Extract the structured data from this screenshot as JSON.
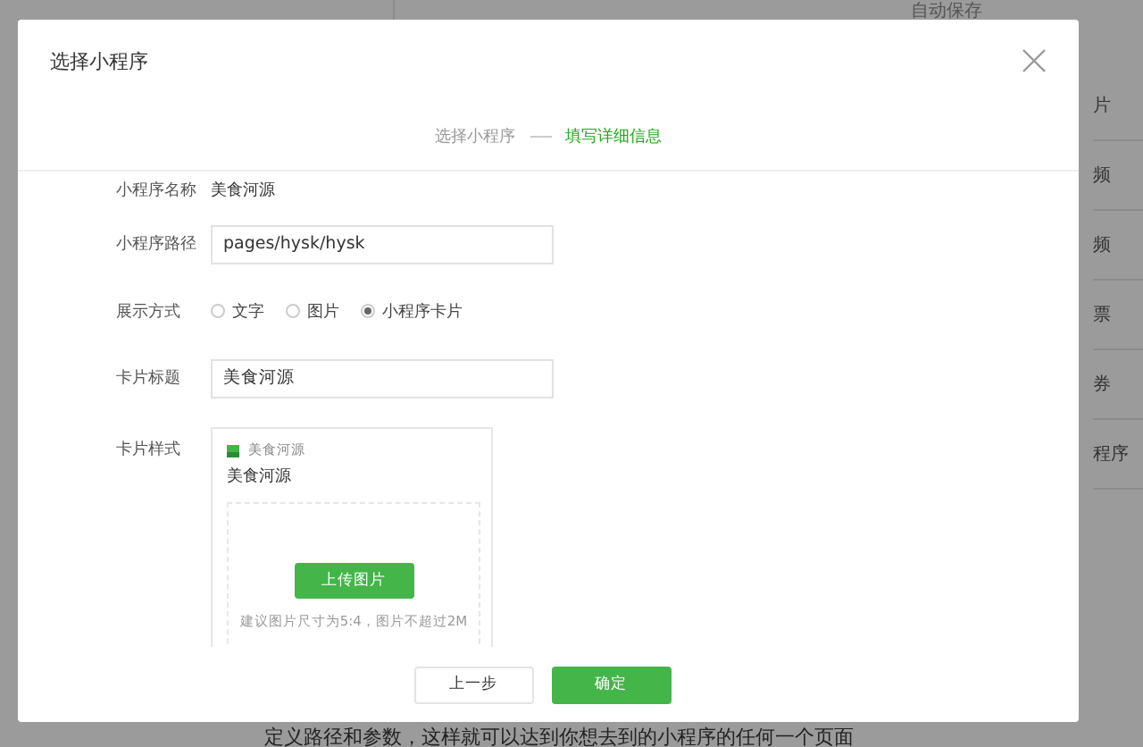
{
  "background": {
    "autosave": "自动保存",
    "side_items": [
      "片",
      "频",
      "频",
      "票",
      "券",
      "程序"
    ],
    "bottom_text": "定义路径和参数，这样就可以达到你想去到的小程序的任何一个页面"
  },
  "dialog": {
    "title": "选择小程序",
    "steps": [
      {
        "label": "选择小程序",
        "selected": false
      },
      {
        "label": "填写详细信息",
        "selected": true
      }
    ],
    "fields": [
      {
        "kind": "text",
        "label": "小程序名称",
        "value": "美食河源"
      },
      {
        "kind": "input",
        "label": "小程序路径",
        "value": "pages/hysk/hysk"
      },
      {
        "kind": "radio",
        "label": "展示方式",
        "options": [
          {
            "label": "文字",
            "selected": false
          },
          {
            "label": "图片",
            "selected": false
          },
          {
            "label": "小程序卡片",
            "selected": true
          }
        ]
      },
      {
        "kind": "input",
        "label": "卡片标题",
        "value": "美食河源"
      },
      {
        "kind": "card",
        "label": "卡片样式",
        "app_name": "美食河源",
        "card_title": "美食河源",
        "upload_button": "上传图片",
        "hint": "建议图片尺寸为5:4，图片不超过2M"
      }
    ],
    "buttons": [
      {
        "label": "上一步",
        "kind": "secondary"
      },
      {
        "label": "确定",
        "kind": "primary"
      }
    ]
  }
}
